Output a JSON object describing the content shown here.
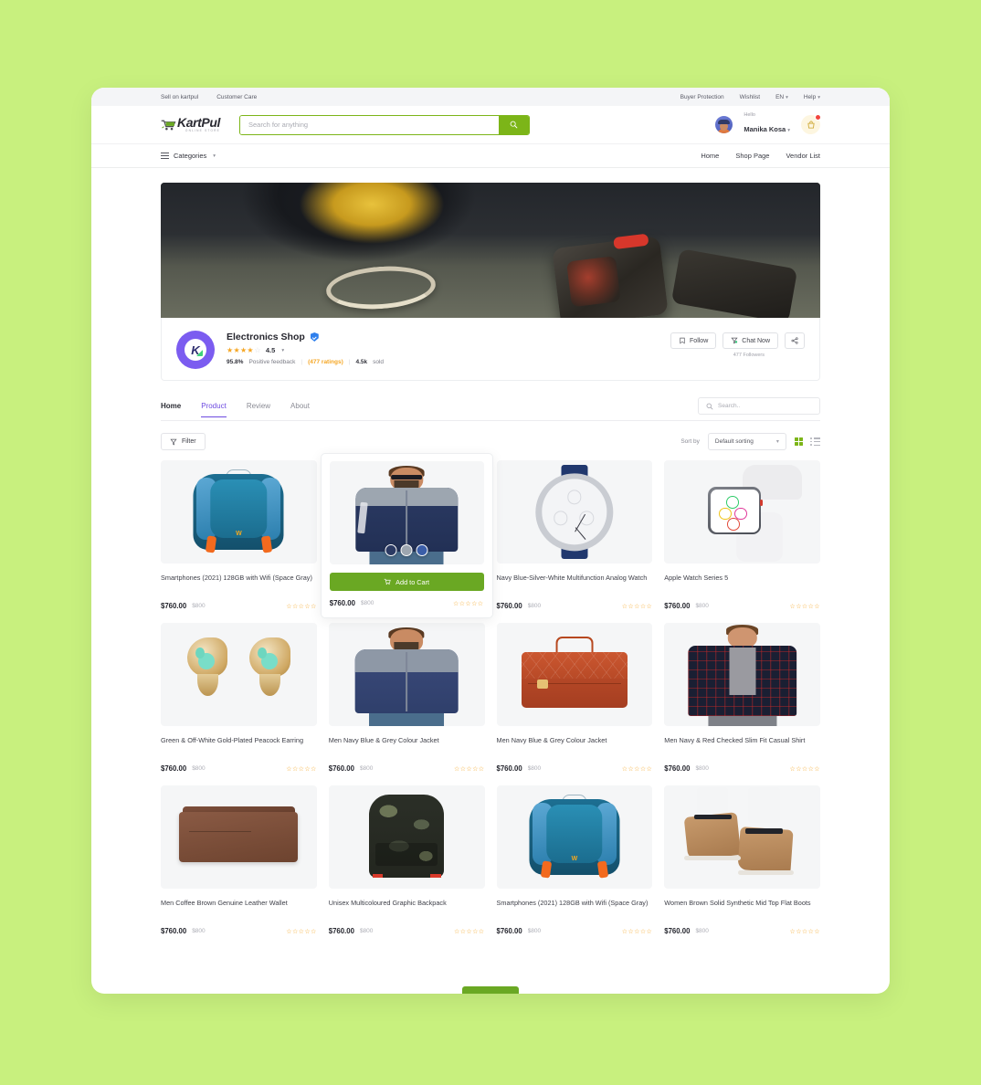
{
  "topbar": {
    "left": [
      "Sell on kartpul",
      "Customer Care"
    ],
    "right": [
      {
        "label": "Buyer Protection",
        "caret": false
      },
      {
        "label": "Wishlist",
        "caret": false
      },
      {
        "label": "EN",
        "caret": true
      },
      {
        "label": "Help",
        "caret": true
      }
    ]
  },
  "header": {
    "logo_name": "KartPul",
    "logo_sub": "ONLINE STORE",
    "search_placeholder": "Search for anything",
    "search_value": "",
    "search_icon": "search-icon",
    "hello_label": "Hello",
    "user_name": "Manika Kosa",
    "cart_icon": "cart-icon"
  },
  "nav": {
    "categories_label": "Categories",
    "links": [
      "Home",
      "Shop Page",
      "Vendor List"
    ]
  },
  "shop": {
    "name": "Electronics Shop",
    "verified": true,
    "rating": "4.5",
    "stars_filled": 4,
    "stars_total": 5,
    "positive_pct": "95.8%",
    "positive_label": "Positive feedback",
    "ratings_count": "(477 ratings)",
    "sold_count": "4.5k",
    "sold_label": "sold",
    "follow_label": "Follow",
    "chat_label": "Chat Now",
    "share_icon": "share-icon",
    "followers": "477 Followers",
    "logo_letter": "K"
  },
  "tabs": [
    {
      "label": "Home",
      "active": false,
      "bold": true
    },
    {
      "label": "Product",
      "active": true,
      "bold": false
    },
    {
      "label": "Review",
      "active": false,
      "bold": false
    },
    {
      "label": "About",
      "active": false,
      "bold": false
    }
  ],
  "tab_search": {
    "placeholder": "Search..",
    "value": "",
    "icon": "search-icon"
  },
  "filterbar": {
    "filter_label": "Filter",
    "filter_icon": "funnel-icon",
    "sort_by_label": "Sort by",
    "sort_value": "Default sorting",
    "grid_view_icon": "grid-view-icon",
    "list_view_icon": "list-view-icon",
    "grid_active_color": "#7cb518"
  },
  "products": [
    {
      "title": "Smartphones (2021) 128GB with Wifi (Space Gray)",
      "price": "$760.00",
      "old_price": "$800",
      "art": "bp-teal",
      "hover": false
    },
    {
      "title": "",
      "price": "$760.00",
      "old_price": "$800",
      "art": "jacket",
      "hover": true,
      "add_to_cart": "Add to Cart",
      "swatches": [
        "#2b3a63",
        "#9da6b0",
        "#3b5ea8"
      ]
    },
    {
      "title": "Navy Blue-Silver-White Multifunction Analog Watch",
      "price": "$760.00",
      "old_price": "$800",
      "art": "watch-a",
      "hover": false
    },
    {
      "title": "Apple Watch Series 5",
      "price": "$760.00",
      "old_price": "$800",
      "art": "watch-d",
      "hover": false
    },
    {
      "title": "Green & Off-White Gold-Plated Peacock Earring",
      "price": "$760.00",
      "old_price": "$800",
      "art": "earr",
      "hover": false
    },
    {
      "title": "Men Navy Blue & Grey Colour Jacket",
      "price": "$760.00",
      "old_price": "$800",
      "art": "jacket2",
      "hover": false
    },
    {
      "title": "Men Navy Blue & Grey Colour Jacket",
      "price": "$760.00",
      "old_price": "$800",
      "art": "bag",
      "hover": false
    },
    {
      "title": "Men Navy & Red Checked Slim Fit Casual Shirt",
      "price": "$760.00",
      "old_price": "$800",
      "art": "shirt",
      "hover": false
    },
    {
      "title": "Men Coffee Brown Genuine Leather Wallet",
      "price": "$760.00",
      "old_price": "$800",
      "art": "wallet",
      "hover": false
    },
    {
      "title": "Unisex Multicoloured Graphic Backpack",
      "price": "$760.00",
      "old_price": "$800",
      "art": "bp-camo",
      "hover": false
    },
    {
      "title": "Smartphones (2021) 128GB with Wifi (Space Gray)",
      "price": "$760.00",
      "old_price": "$800",
      "art": "bp-teal",
      "hover": false
    },
    {
      "title": "Women Brown Solid Synthetic Mid Top Flat Boots",
      "price": "$760.00",
      "old_price": "$800",
      "art": "boots",
      "hover": false
    }
  ],
  "colors": {
    "page_bg": "#c8f07e",
    "brand_green": "#7cb518",
    "accent_purple": "#6d4ae0",
    "star_gold": "#f5a623",
    "cart_badge": "#f2453d"
  }
}
